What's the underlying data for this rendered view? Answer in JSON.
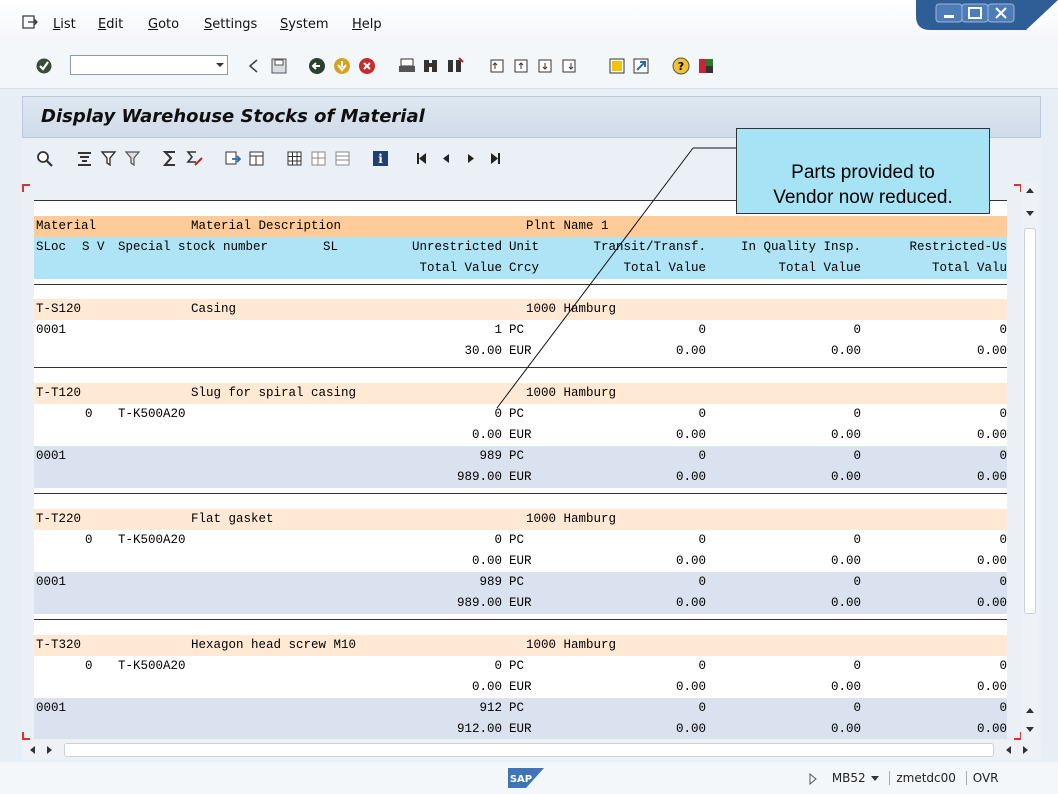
{
  "menu": [
    "List",
    "Edit",
    "Goto",
    "Settings",
    "System",
    "Help"
  ],
  "command_field": {
    "value": ""
  },
  "page_title": "Display Warehouse Stocks of Material",
  "header": {
    "row1": {
      "material": "Material",
      "desc": "Material Description",
      "plant": "Plnt Name 1"
    },
    "row2": {
      "sloc": "SLoc",
      "sv": "S V",
      "ssn": "Special stock number",
      "sl": "SL",
      "unres": "Unrestricted",
      "unit": "Unit",
      "transit": "Transit/Transf.",
      "quality": "In Quality Insp.",
      "restricted": "Restricted-Us"
    },
    "row3": {
      "total": "Total Value",
      "crcy": "Crcy",
      "t1": "Total Value",
      "t2": "Total Value",
      "t3": "Total Valu"
    }
  },
  "materials": [
    {
      "material": "T-S120",
      "desc": "Casing",
      "plant": "1000 Hamburg",
      "lines": [
        {
          "sloc": "0001",
          "sv": "",
          "ssn": "",
          "qty": "1",
          "unit": "PC",
          "transit": "0",
          "quality": "0",
          "restricted": "0",
          "value": "30.00",
          "crcy": "EUR",
          "v1": "0.00",
          "v2": "0.00",
          "v3": "0.00"
        }
      ]
    },
    {
      "material": "T-T120",
      "desc": "Slug for spiral casing",
      "plant": "1000 Hamburg",
      "lines": [
        {
          "sloc": "",
          "sv": "0",
          "ssn": "T-K500A20",
          "qty": "0",
          "unit": "PC",
          "transit": "0",
          "quality": "0",
          "restricted": "0",
          "value": "0.00",
          "crcy": "EUR",
          "v1": "0.00",
          "v2": "0.00",
          "v3": "0.00"
        },
        {
          "sloc": "0001",
          "sv": "",
          "ssn": "",
          "qty": "989",
          "unit": "PC",
          "transit": "0",
          "quality": "0",
          "restricted": "0",
          "value": "989.00",
          "crcy": "EUR",
          "v1": "0.00",
          "v2": "0.00",
          "v3": "0.00"
        }
      ]
    },
    {
      "material": "T-T220",
      "desc": "Flat gasket",
      "plant": "1000 Hamburg",
      "lines": [
        {
          "sloc": "",
          "sv": "0",
          "ssn": "T-K500A20",
          "qty": "0",
          "unit": "PC",
          "transit": "0",
          "quality": "0",
          "restricted": "0",
          "value": "0.00",
          "crcy": "EUR",
          "v1": "0.00",
          "v2": "0.00",
          "v3": "0.00"
        },
        {
          "sloc": "0001",
          "sv": "",
          "ssn": "",
          "qty": "989",
          "unit": "PC",
          "transit": "0",
          "quality": "0",
          "restricted": "0",
          "value": "989.00",
          "crcy": "EUR",
          "v1": "0.00",
          "v2": "0.00",
          "v3": "0.00"
        }
      ]
    },
    {
      "material": "T-T320",
      "desc": "Hexagon head screw M10",
      "plant": "1000 Hamburg",
      "lines": [
        {
          "sloc": "",
          "sv": "0",
          "ssn": "T-K500A20",
          "qty": "0",
          "unit": "PC",
          "transit": "0",
          "quality": "0",
          "restricted": "0",
          "value": "0.00",
          "crcy": "EUR",
          "v1": "0.00",
          "v2": "0.00",
          "v3": "0.00"
        },
        {
          "sloc": "0001",
          "sv": "",
          "ssn": "",
          "qty": "912",
          "unit": "PC",
          "transit": "0",
          "quality": "0",
          "restricted": "0",
          "value": "912.00",
          "crcy": "EUR",
          "v1": "0.00",
          "v2": "0.00",
          "v3": "0.00"
        }
      ]
    }
  ],
  "callout": {
    "line1": "Parts provided to",
    "line2": "Vendor now reduced."
  },
  "status": {
    "transaction": "MB52",
    "system": "zmetdc00",
    "mode": "OVR"
  },
  "colors": {
    "header_orange": "#ffcc99",
    "header_cyan": "#aee4f5",
    "material_row": "#ffe9d4",
    "stripe": "#d9e2ee",
    "callout": "#a5e3f5"
  }
}
